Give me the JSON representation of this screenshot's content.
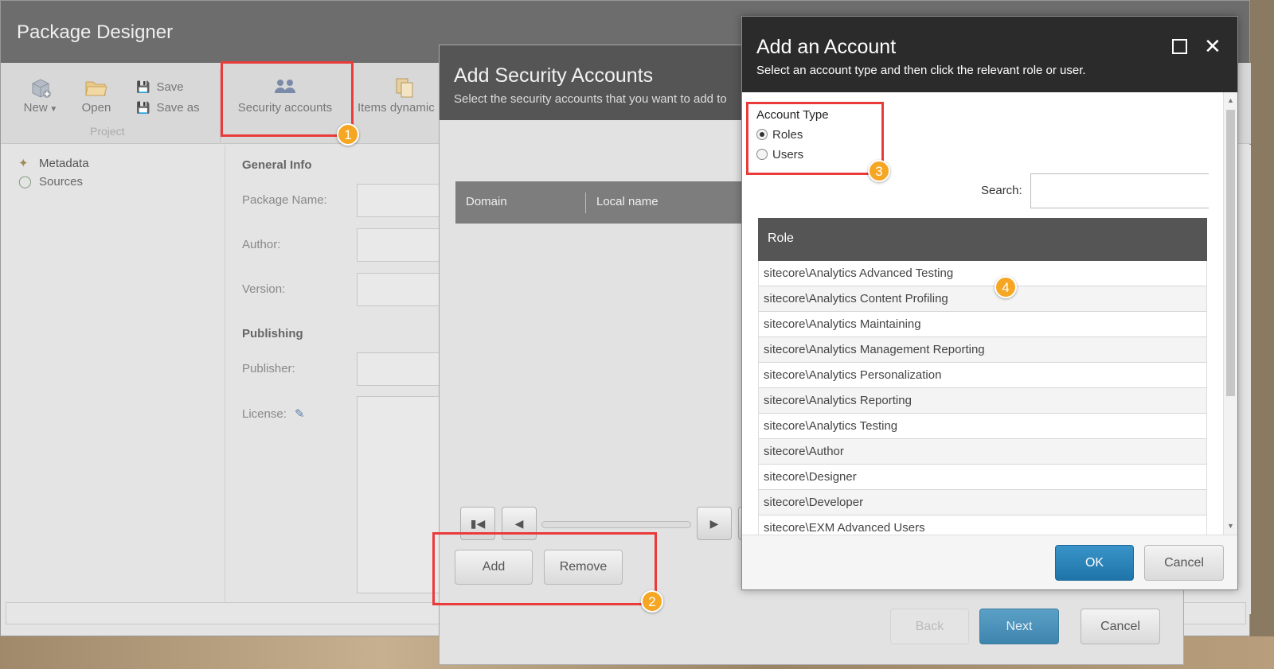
{
  "window_title": "Package Designer",
  "ribbon": {
    "new_label": "New",
    "open_label": "Open",
    "save_label": "Save",
    "save_as_label": "Save as",
    "group_label": "Project",
    "security_accounts_label": "Security accounts",
    "items_dynamic_label": "Items dynamic"
  },
  "tree": [
    {
      "label": "Metadata"
    },
    {
      "label": "Sources"
    }
  ],
  "form": {
    "general_info": "General Info",
    "package_name": "Package Name:",
    "author": "Author:",
    "version": "Version:",
    "publishing": "Publishing",
    "publisher": "Publisher:",
    "license": "License:"
  },
  "security_dialog": {
    "title": "Add Security Accounts",
    "subtitle": "Select the security accounts that you want to add to",
    "columns": [
      "Domain",
      "Local name"
    ],
    "add_label": "Add",
    "remove_label": "Remove",
    "back_label": "Back",
    "next_label": "Next",
    "cancel_label": "Cancel"
  },
  "account_dialog": {
    "title": "Add an Account",
    "subtitle": "Select an account type and then click the relevant role or user.",
    "account_type_label": "Account Type",
    "roles_label": "Roles",
    "users_label": "Users",
    "selected_type": "Roles",
    "search_label": "Search:",
    "search_value": "",
    "role_column": "Role",
    "roles": [
      "sitecore\\Analytics Advanced Testing",
      "sitecore\\Analytics Content Profiling",
      "sitecore\\Analytics Maintaining",
      "sitecore\\Analytics Management Reporting",
      "sitecore\\Analytics Personalization",
      "sitecore\\Analytics Reporting",
      "sitecore\\Analytics Testing",
      "sitecore\\Author",
      "sitecore\\Designer",
      "sitecore\\Developer",
      "sitecore\\EXM Advanced Users"
    ],
    "ok_label": "OK",
    "cancel_label": "Cancel"
  },
  "callouts": [
    "1",
    "2",
    "3",
    "4"
  ],
  "colors": {
    "highlight": "#ea3a3a",
    "badge": "#f5a623",
    "primary_button": "#1e74a8"
  }
}
